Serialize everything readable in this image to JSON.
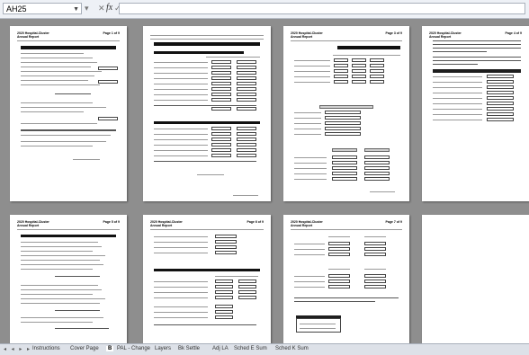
{
  "name_box": "AH25",
  "fx_label": "fx",
  "toolbar_glyphs": "▾ ✕ ✓",
  "sheet_tabs": [
    "Instructions",
    "Cover Page",
    "B",
    "PAL - Change",
    "Layers",
    "Bk Settle",
    "Adj LA",
    "Sched E Sum",
    "Sched K Sum"
  ],
  "active_tab_index": 2,
  "pages": [
    {
      "title": "2020 Hospital-Cluster\nAnnual Report",
      "page_label": "Page 1 of 9"
    },
    {
      "title": "",
      "page_label": ""
    },
    {
      "title": "2020 Hospital-Cluster\nAnnual Report",
      "page_label": "Page 3 of 9"
    },
    {
      "title": "2020 Hospital-Cluster\nAnnual Report",
      "page_label": "Page 4 of 9"
    },
    {
      "title": "2020 Hospital-Cluster\nAnnual Report",
      "page_label": "Page 5 of 9"
    },
    {
      "title": "2020 Hospital-Cluster\nAnnual Report",
      "page_label": "Page 6 of 9"
    },
    {
      "title": "2020 Hospital-Cluster\nAnnual Report",
      "page_label": "Page 7 of 9"
    },
    {
      "title": "",
      "page_label": ""
    }
  ],
  "colors": {
    "workspace": "#8e8e8e",
    "page": "#ffffff",
    "header_bar": "#111111"
  }
}
